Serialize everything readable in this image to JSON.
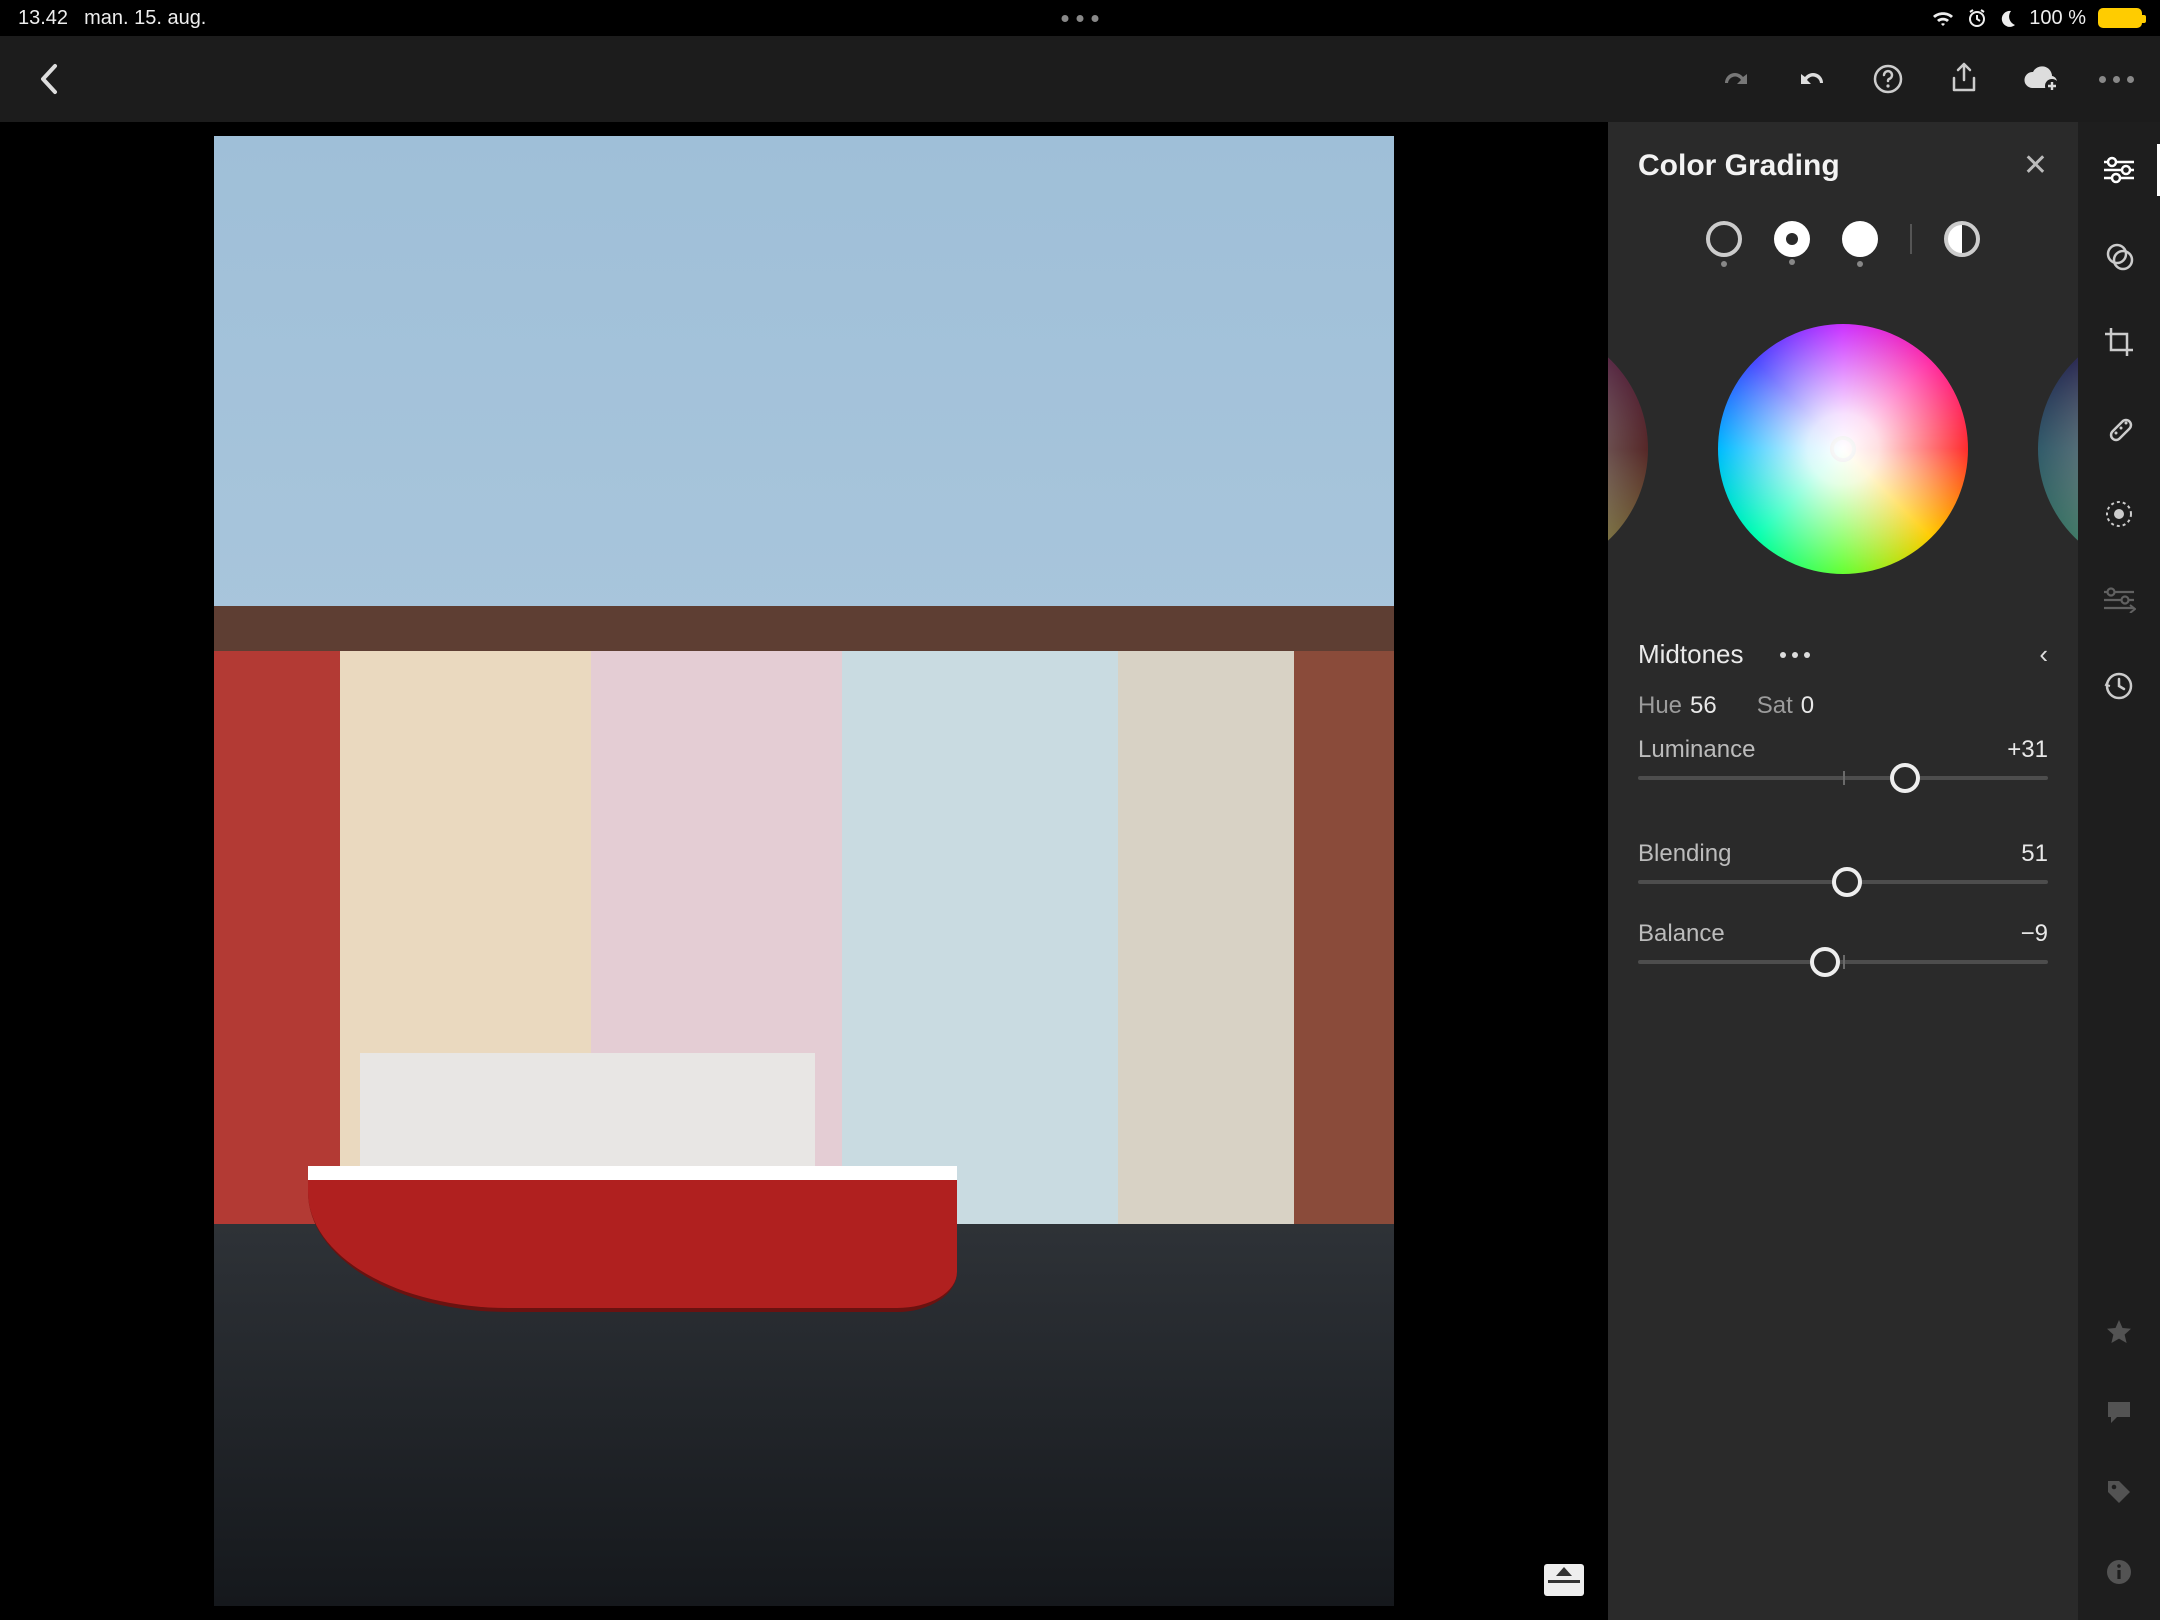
{
  "status": {
    "time": "13.42",
    "date": "man. 15. aug.",
    "battery_pct": "100 %"
  },
  "panel": {
    "title": "Color Grading",
    "section_label": "Midtones",
    "hue_label": "Hue",
    "hue_value": "56",
    "sat_label": "Sat",
    "sat_value": "0",
    "luminance_label": "Luminance",
    "luminance_value": "+31",
    "blending_label": "Blending",
    "blending_value": "51",
    "balance_label": "Balance",
    "balance_value": "−9"
  },
  "sliders": {
    "luminance_pos": "65%",
    "blending_pos": "51%",
    "balance_pos": "45.5%"
  }
}
